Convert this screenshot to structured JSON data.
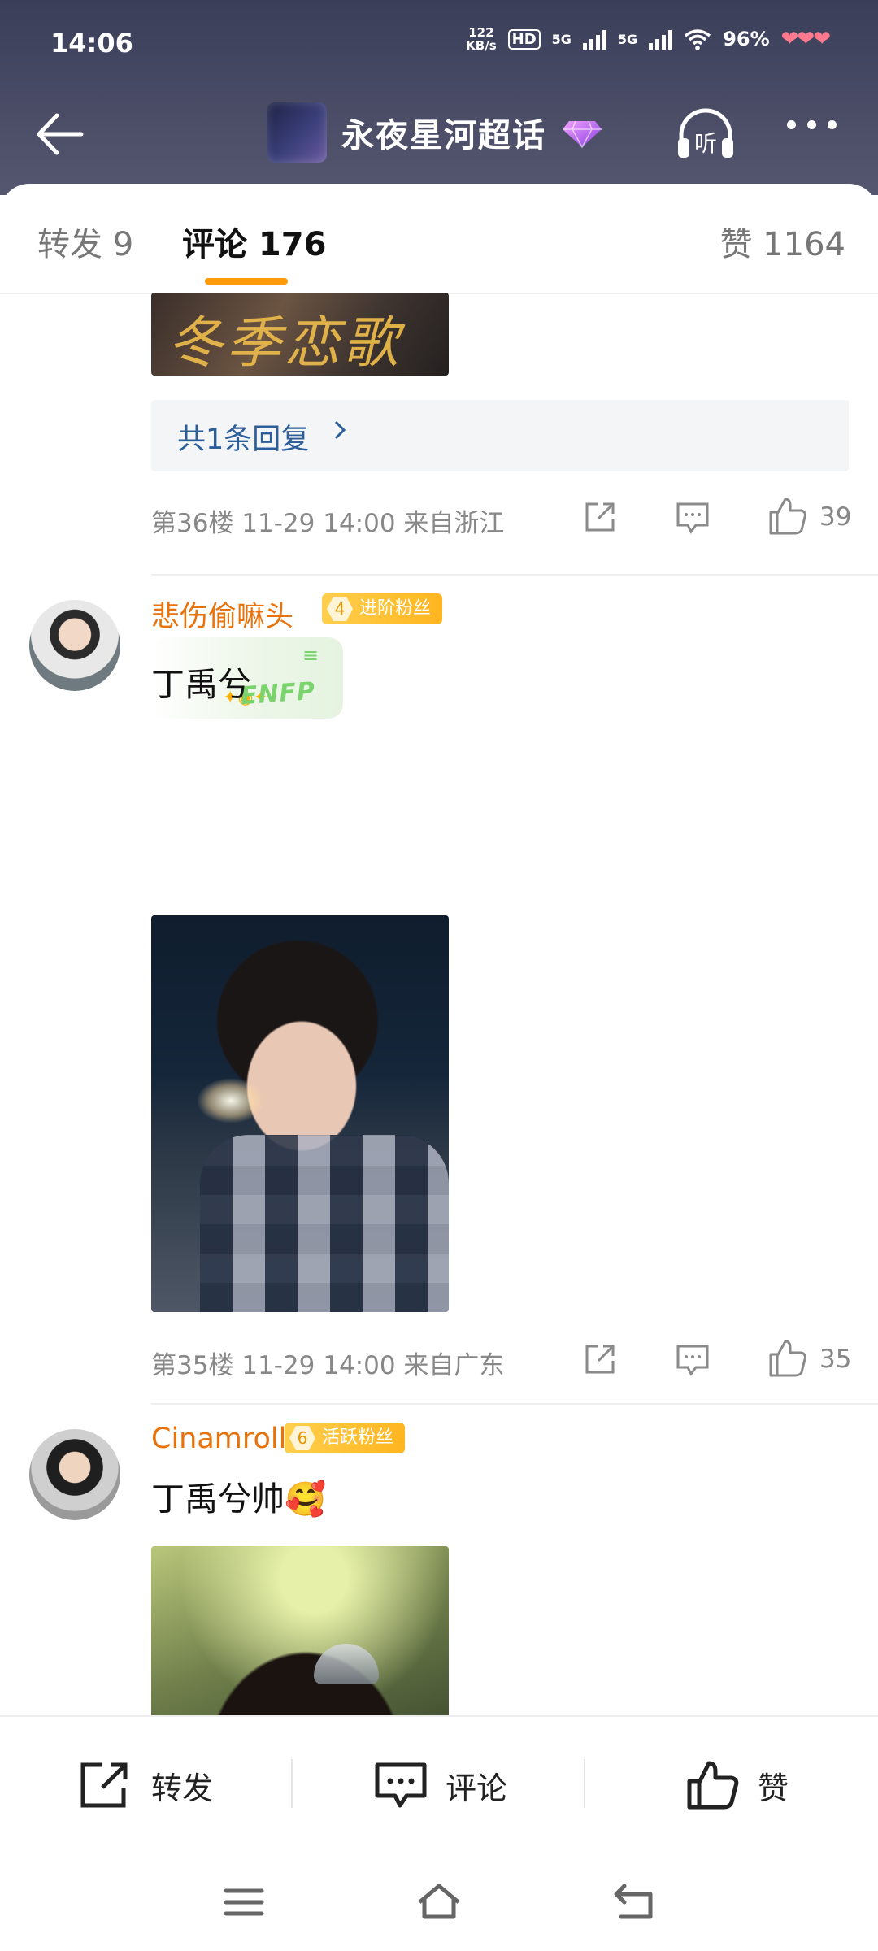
{
  "status_bar": {
    "time": "14:06",
    "net_speed": "122",
    "net_unit": "KB/s",
    "hd_label": "HD",
    "sim1": "5G",
    "sim2": "5G",
    "battery": "96%",
    "hearts": "❤❤❤"
  },
  "header": {
    "title": "永夜星河超话",
    "listen_label": "听"
  },
  "tabs": {
    "repost": "转发 9",
    "comment": "评论 176",
    "like": "赞 1164"
  },
  "top_image": {
    "caption": "冬季恋歌"
  },
  "replies_link": {
    "label": "共1条回复"
  },
  "comments": [
    {
      "meta": "第36楼  11-29 14:00  来自浙江",
      "likes": "39"
    },
    {
      "username": "悲伤偷嘛头",
      "badge_level": "4",
      "badge_text": "进阶粉丝",
      "text": "丁禹兮",
      "sticker_text": "ENFP",
      "meta": "第35楼  11-29 14:00  来自广东",
      "likes": "35"
    },
    {
      "username": "Cinamroll",
      "badge_level": "6",
      "badge_text": "活跃粉丝",
      "text": "丁禹兮帅🥰"
    }
  ],
  "bottom_bar": {
    "repost": "转发",
    "comment": "评论",
    "like": "赞"
  },
  "colors": {
    "accent": "#ff9a0a",
    "username": "#e8730c",
    "link": "#2c5e9a"
  }
}
